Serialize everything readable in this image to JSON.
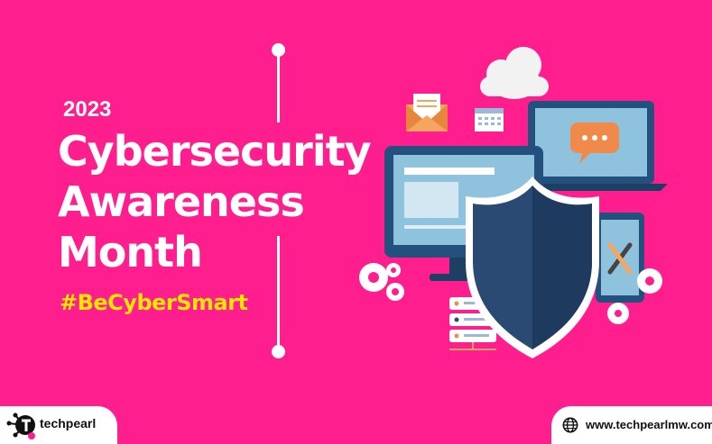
{
  "banner": {
    "year": "2023",
    "title_lines": [
      "Cybersecurity",
      "Awareness",
      "Month"
    ],
    "hashtag": "#BeCyberSmart"
  },
  "brand": {
    "name": "techpearl",
    "website": "www.techpearlmw.com"
  },
  "illustration": {
    "icons": [
      "cloud-icon",
      "envelope-icon",
      "calendar-icon",
      "laptop-icon",
      "chat-bubble-icon",
      "monitor-icon",
      "shield-icon",
      "gear-icon",
      "server-icon",
      "tablet-icon",
      "wrench-icon"
    ]
  },
  "colors": {
    "background": "#FF1E8E",
    "hashtag": "#FFE600",
    "shield_dark": "#2A4A73",
    "screen": "#8FC3DD",
    "device_frame": "#24507E"
  }
}
